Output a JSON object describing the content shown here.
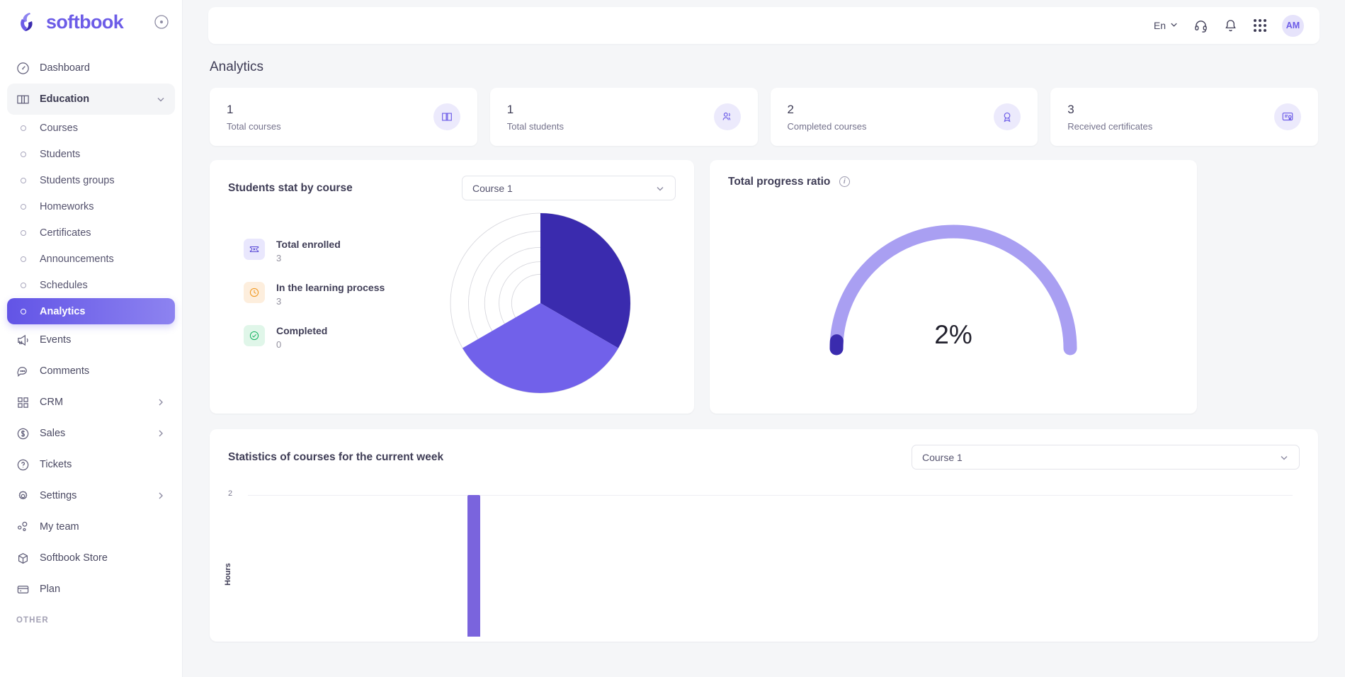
{
  "brand": {
    "name": "softbook",
    "collapse_icon": "collapse-circle-icon"
  },
  "sidebar": {
    "items": [
      {
        "label": "Dashboard",
        "icon": "speedometer-icon",
        "type": "item"
      },
      {
        "label": "Education",
        "icon": "book-open-icon",
        "type": "group",
        "expanded": true
      },
      {
        "label": "Courses",
        "icon": "bullet-dot-icon",
        "type": "sub"
      },
      {
        "label": "Students",
        "icon": "bullet-dot-icon",
        "type": "sub"
      },
      {
        "label": "Students groups",
        "icon": "bullet-dot-icon",
        "type": "sub"
      },
      {
        "label": "Homeworks",
        "icon": "bullet-dot-icon",
        "type": "sub"
      },
      {
        "label": "Certificates",
        "icon": "bullet-dot-icon",
        "type": "sub"
      },
      {
        "label": "Announcements",
        "icon": "bullet-dot-icon",
        "type": "sub"
      },
      {
        "label": "Schedules",
        "icon": "bullet-dot-icon",
        "type": "sub"
      },
      {
        "label": "Analytics",
        "icon": "bullet-dot-icon",
        "type": "sub",
        "active": true
      },
      {
        "label": "Events",
        "icon": "megaphone-icon",
        "type": "item"
      },
      {
        "label": "Comments",
        "icon": "chat-bubble-icon",
        "type": "item"
      },
      {
        "label": "CRM",
        "icon": "grid-squares-icon",
        "type": "item",
        "chevron": true
      },
      {
        "label": "Sales",
        "icon": "dollar-circle-icon",
        "type": "item",
        "chevron": true
      },
      {
        "label": "Tickets",
        "icon": "question-circle-icon",
        "type": "item"
      },
      {
        "label": "Settings",
        "icon": "gear-icon",
        "type": "item",
        "chevron": true
      },
      {
        "label": "My team",
        "icon": "team-icon",
        "type": "item"
      },
      {
        "label": "Softbook Store",
        "icon": "box-icon",
        "type": "item"
      },
      {
        "label": "Plan",
        "icon": "card-icon",
        "type": "item"
      }
    ],
    "section_other": "OTHER"
  },
  "topbar": {
    "language": "En",
    "headset_icon": "headset-icon",
    "bell_icon": "bell-icon",
    "apps_icon": "apps-grid-icon",
    "avatar_initials": "AM"
  },
  "page": {
    "title": "Analytics"
  },
  "stats": [
    {
      "value": "1",
      "label": "Total courses",
      "icon": "book-icon"
    },
    {
      "value": "1",
      "label": "Total students",
      "icon": "users-icon"
    },
    {
      "value": "2",
      "label": "Completed courses",
      "icon": "award-icon"
    },
    {
      "value": "3",
      "label": "Received certificates",
      "icon": "certificate-icon"
    }
  ],
  "students_stat": {
    "title": "Students stat by course",
    "course_select": {
      "value": "Course 1",
      "options": [
        "Course 1"
      ]
    },
    "legend": [
      {
        "name": "Total enrolled",
        "value": "3",
        "icon": "ticket-icon",
        "color": "#5b4bd6"
      },
      {
        "name": "In the learning process",
        "value": "3",
        "icon": "clock-icon",
        "color": "#f0971e"
      },
      {
        "name": "Completed",
        "value": "0",
        "icon": "check-circle-icon",
        "color": "#18b563"
      }
    ]
  },
  "progress": {
    "title": "Total progress ratio",
    "info_icon": "info-icon",
    "percent_label": "2%",
    "percent_value": 2
  },
  "weekly": {
    "title": "Statistics of courses for the current week",
    "course_select": {
      "value": "Course 1",
      "options": [
        "Course 1"
      ]
    }
  },
  "chart_data": [
    {
      "type": "pie",
      "title": "Students stat by course",
      "categories": [
        "Total enrolled",
        "In the learning process",
        "Completed"
      ],
      "values": [
        3,
        3,
        0
      ],
      "colors": [
        "#3a2bae",
        "#7161ea",
        "#ffffff"
      ],
      "legend": "left",
      "note": "three equal 120-degree sectors; third sector empty with concentric guide rings",
      "sector_degrees": [
        120,
        120,
        120
      ]
    },
    {
      "type": "gauge",
      "title": "Total progress ratio",
      "values": [
        2
      ],
      "ylim": [
        0,
        100
      ],
      "unit": "%",
      "value_label": "2%",
      "track_color": "#a99ff2",
      "fill_color": "#3a2bae"
    },
    {
      "type": "bar",
      "title": "Statistics of courses for the current week",
      "categories": [
        ""
      ],
      "values": [
        2
      ],
      "ylabel": "Hours",
      "ytick_labels": [
        "2"
      ],
      "ylim": [
        0,
        2
      ],
      "grid": true,
      "bar_color": "#7a64dd",
      "note": "chart is clipped by viewport bottom; single bar reaching value 2"
    }
  ]
}
